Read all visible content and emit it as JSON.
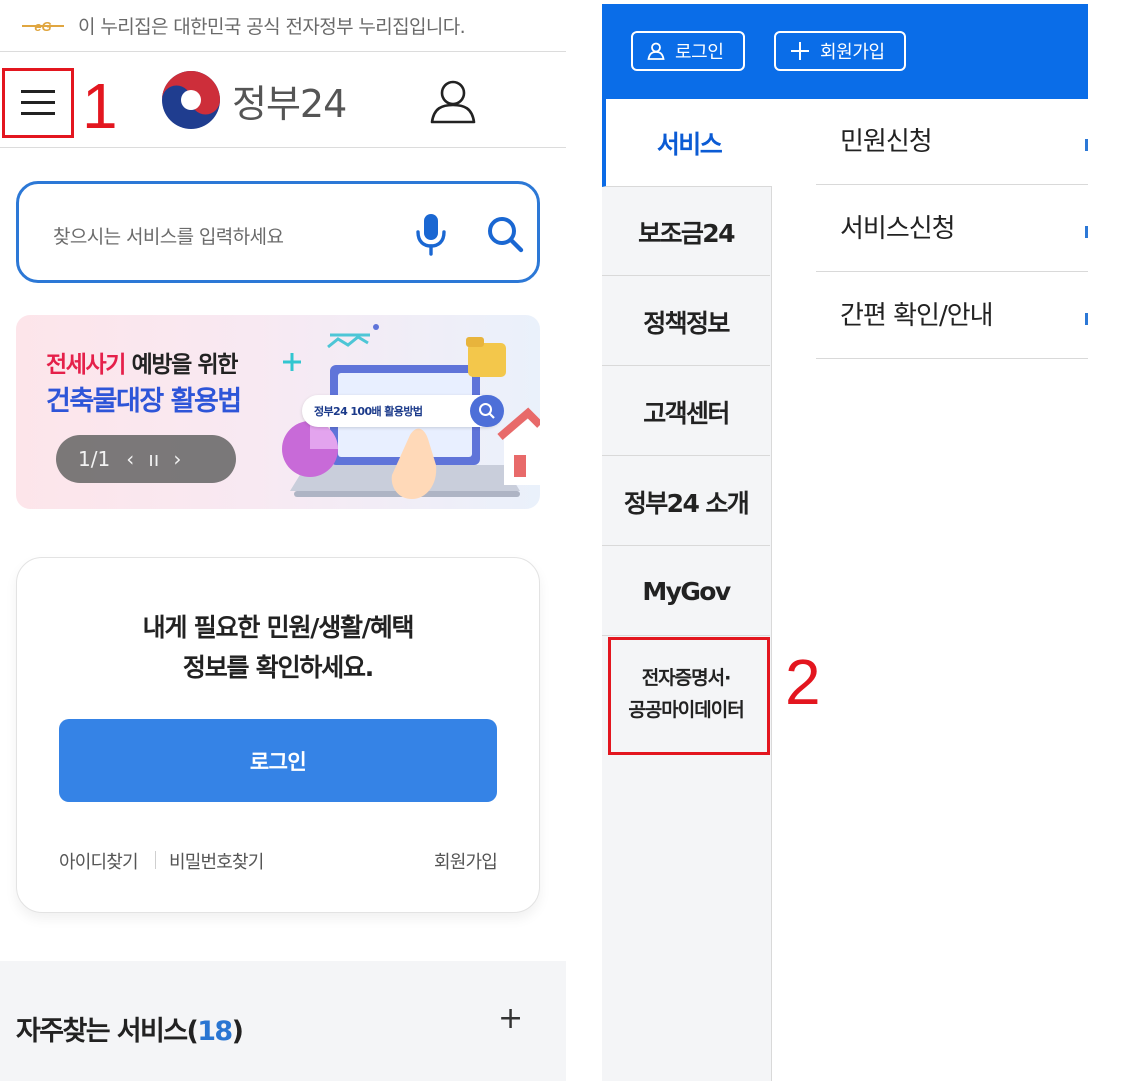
{
  "left": {
    "gov_notice": "이 누리집은 대한민국 공식 전자정부 누리집입니다.",
    "logo_text": "정부24",
    "annotation_1": "1",
    "search": {
      "placeholder": "찾으시는 서비스를 입력하세요"
    },
    "banner": {
      "line1_red": "전세사기",
      "line1_dark": " 예방을 위한",
      "line2": "건축물대장 활용법",
      "pager_text": "1/1",
      "prev": "‹",
      "pause": "ıı",
      "next": "›",
      "pill_text": "정부24 100배 활용방법"
    },
    "login_card": {
      "message_line1": "내게 필요한 민원/생활/혜택",
      "message_line2": "정보를 확인하세요.",
      "login_button": "로그인",
      "find_id": "아이디찾기",
      "find_pw": "비밀번호찾기",
      "join": "회원가입"
    },
    "frequent": {
      "title": "자주찾는 서비스(",
      "count": "18",
      "title_end": ")",
      "plus": "+"
    }
  },
  "right": {
    "topbar": {
      "login": "로그인",
      "join": "회원가입"
    },
    "side_menu": [
      "서비스",
      "보조금24",
      "정책정보",
      "고객센터",
      "정부24 소개",
      "MyGov",
      "전자증명서·",
      "공공마이데이터"
    ],
    "submenu": [
      "민원신청",
      "서비스신청",
      "간편 확인/안내"
    ],
    "annotation_2": "2"
  },
  "colors": {
    "brand_blue": "#0a6de8",
    "button_blue": "#3583e6",
    "annotation_red": "#e3161f",
    "banner_red": "#e5204a",
    "banner_blue": "#2e55d8"
  },
  "icons": [
    "eg-logo-icon",
    "hamburger-icon",
    "taegeuk-logo-icon",
    "user-icon",
    "microphone-icon",
    "search-icon",
    "plus-icon"
  ]
}
